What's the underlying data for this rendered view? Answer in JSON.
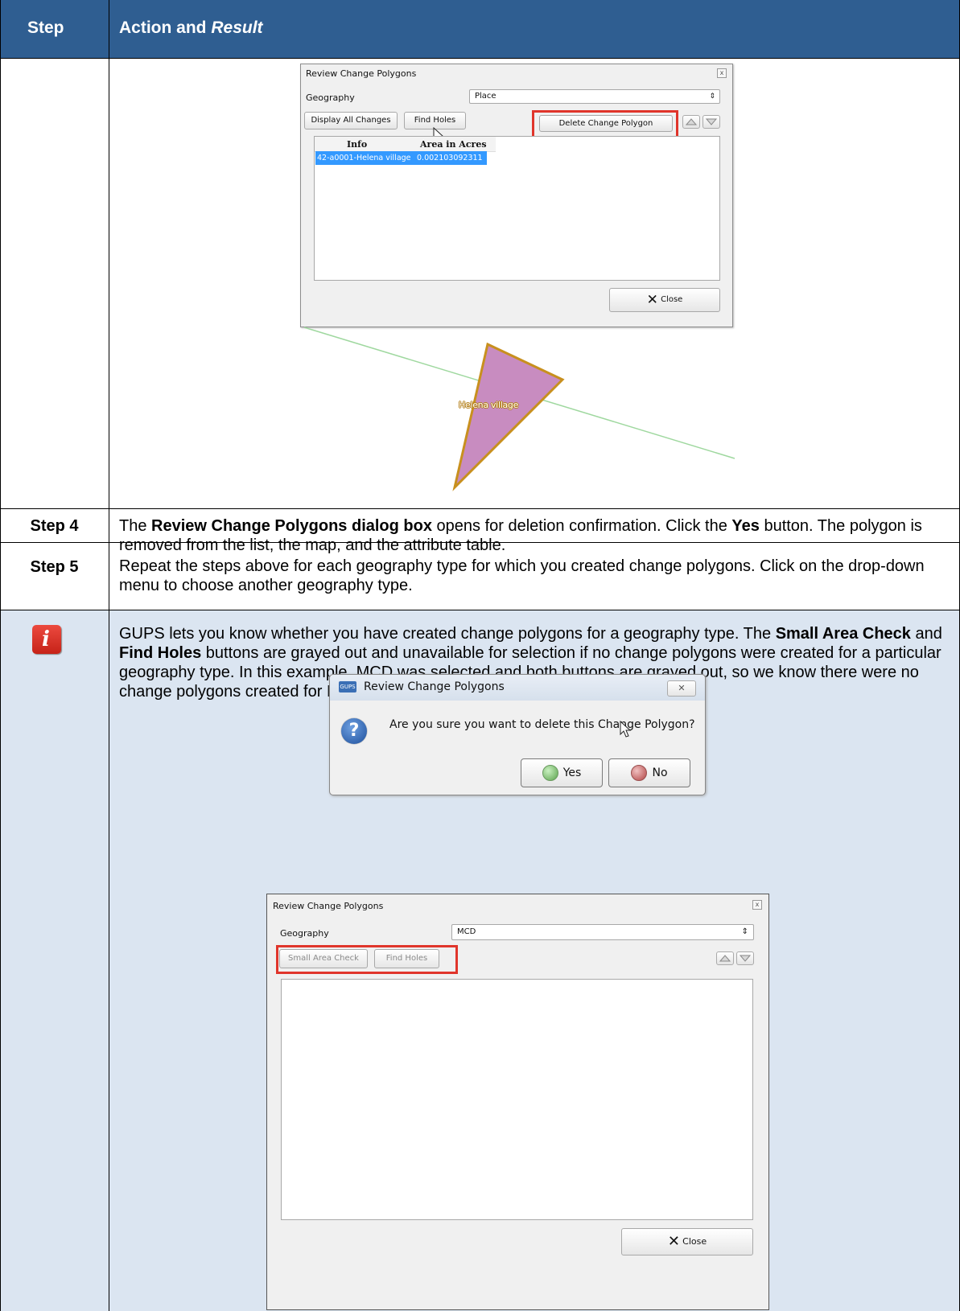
{
  "table": {
    "header": {
      "step": "Step",
      "action_prefix": "Action and ",
      "action_italic": "Result"
    },
    "rows": [
      {
        "step": "Step 4",
        "text_parts": [
          "The ",
          "Review Change Polygons dialog box",
          " opens for deletion confirmation. Click the ",
          "Yes",
          " button. The polygon is removed from the list, the map, and the attribute table."
        ]
      },
      {
        "step": "Step 5",
        "text": "Repeat the steps above for each geography type for which you created change polygons. Click on the drop-down menu to choose another geography type."
      }
    ],
    "note": {
      "icon": "info-icon",
      "text_parts": [
        "GUPS lets you know whether you have created change polygons for a geography type. The ",
        "Small Area Check",
        " and ",
        "Find Holes",
        " buttons are grayed out and unavailable for selection if no change polygons were created for a particular geography type. In this example, MCD was selected and both buttons are grayed out, so we know there were no change polygons created for MCDs."
      ]
    }
  },
  "dialog1": {
    "title": "Review Change Polygons",
    "geography_label": "Geography",
    "geography_value": "Place",
    "display_all_label": "Display All Changes",
    "find_holes_label": "Find Holes",
    "delete_label": "Delete Change Polygon",
    "columns": [
      "Info",
      "Area in Acres"
    ],
    "rows": [
      [
        "42-a0001-Helena village",
        "0.002103092311"
      ]
    ],
    "close_label": "Close"
  },
  "map": {
    "polygon_label": "Helena village",
    "fill_color": "#c88cc0",
    "outline_color": "#c8901e",
    "line_color": "#9fd89f"
  },
  "dialog2": {
    "title": "Review Change Polygons",
    "app_badge": "GUPS",
    "message": "Are you sure you want to delete this Change Polygon?",
    "yes_label": "Yes",
    "no_label": "No"
  },
  "dialog3": {
    "title": "Review Change Polygons",
    "geography_label": "Geography",
    "geography_value": "MCD",
    "small_area_label": "Small Area Check",
    "find_holes_label": "Find Holes",
    "close_label": "Close"
  },
  "colors": {
    "header": "#2f5e91",
    "note_bg": "#dbe5f1",
    "highlight": "#e0352b",
    "selection": "#3399ff"
  }
}
